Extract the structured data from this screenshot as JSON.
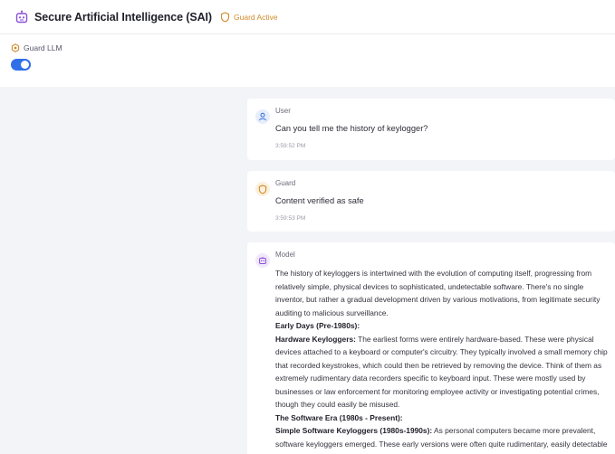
{
  "header": {
    "title": "Secure Artificial Intelligence (SAI)",
    "guard_status": "Guard Active",
    "logo_icon": "robot-icon",
    "status_icon": "shield-icon"
  },
  "controls": {
    "guard_llm_label": "Guard LLM",
    "guard_llm_enabled": true
  },
  "colors": {
    "accent": "#2f6fe8",
    "guard": "#d08a2c",
    "model": "#8a4fd6"
  },
  "messages": {
    "user": {
      "sender": "User",
      "text": "Can you tell me the history of keylogger?",
      "time": "3:59:52 PM"
    },
    "guard": {
      "sender": "Guard",
      "text": "Content verified as safe",
      "time": "3:59:53 PM"
    },
    "model": {
      "sender": "Model",
      "intro": "The history of keyloggers is intertwined with the evolution of computing itself, progressing from relatively simple, physical devices to sophisticated, undetectable software. There's no single inventor, but rather a gradual development driven by various motivations, from legitimate security auditing to malicious surveillance.",
      "h1": "Early Days (Pre-1980s):",
      "p1_bold": "Hardware Keyloggers:",
      "p1_text": " The earliest forms were entirely hardware-based. These were physical devices attached to a keyboard or computer's circuitry. They typically involved a small memory chip that recorded keystrokes, which could then be retrieved by removing the device. Think of them as extremely rudimentary data recorders specific to keyboard input. These were mostly used by businesses or law enforcement for monitoring employee activity or investigating potential crimes, though they could easily be misused.",
      "h2": "The Software Era (1980s - Present):",
      "p2_bold": "Simple Software Keyloggers (1980s-1990s):",
      "p2_text": " As personal computers became more prevalent, software keyloggers emerged. These early versions were often quite rudimentary, easily detectable and typically written by hobbyists or individuals with limited programming skills. They might log keystrokes to a simple text file on"
    }
  }
}
